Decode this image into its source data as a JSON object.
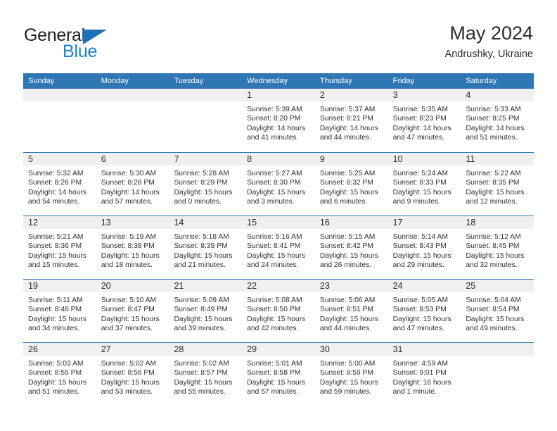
{
  "brand": {
    "name_top": "General",
    "name_bottom": "Blue",
    "triangle_icon": "triangle-logo-icon",
    "color_dark": "#231f20",
    "color_blue": "#1c7fd4"
  },
  "header": {
    "title": "May 2024",
    "subtitle": "Andrushky, Ukraine"
  },
  "theme": {
    "header_blue": "#2f76b5",
    "daynum_band": "#f0f0f0",
    "text": "#303030"
  },
  "calendar": {
    "weekday_headers": [
      "Sunday",
      "Monday",
      "Tuesday",
      "Wednesday",
      "Thursday",
      "Friday",
      "Saturday"
    ],
    "weeks": [
      [
        {
          "day": "",
          "lines": []
        },
        {
          "day": "",
          "lines": []
        },
        {
          "day": "",
          "lines": []
        },
        {
          "day": "1",
          "lines": [
            "Sunrise: 5:39 AM",
            "Sunset: 8:20 PM",
            "Daylight: 14 hours",
            "and 41 minutes."
          ]
        },
        {
          "day": "2",
          "lines": [
            "Sunrise: 5:37 AM",
            "Sunset: 8:21 PM",
            "Daylight: 14 hours",
            "and 44 minutes."
          ]
        },
        {
          "day": "3",
          "lines": [
            "Sunrise: 5:35 AM",
            "Sunset: 8:23 PM",
            "Daylight: 14 hours",
            "and 47 minutes."
          ]
        },
        {
          "day": "4",
          "lines": [
            "Sunrise: 5:33 AM",
            "Sunset: 8:25 PM",
            "Daylight: 14 hours",
            "and 51 minutes."
          ]
        }
      ],
      [
        {
          "day": "5",
          "lines": [
            "Sunrise: 5:32 AM",
            "Sunset: 8:26 PM",
            "Daylight: 14 hours",
            "and 54 minutes."
          ]
        },
        {
          "day": "6",
          "lines": [
            "Sunrise: 5:30 AM",
            "Sunset: 8:28 PM",
            "Daylight: 14 hours",
            "and 57 minutes."
          ]
        },
        {
          "day": "7",
          "lines": [
            "Sunrise: 5:28 AM",
            "Sunset: 8:29 PM",
            "Daylight: 15 hours",
            "and 0 minutes."
          ]
        },
        {
          "day": "8",
          "lines": [
            "Sunrise: 5:27 AM",
            "Sunset: 8:30 PM",
            "Daylight: 15 hours",
            "and 3 minutes."
          ]
        },
        {
          "day": "9",
          "lines": [
            "Sunrise: 5:25 AM",
            "Sunset: 8:32 PM",
            "Daylight: 15 hours",
            "and 6 minutes."
          ]
        },
        {
          "day": "10",
          "lines": [
            "Sunrise: 5:24 AM",
            "Sunset: 8:33 PM",
            "Daylight: 15 hours",
            "and 9 minutes."
          ]
        },
        {
          "day": "11",
          "lines": [
            "Sunrise: 5:22 AM",
            "Sunset: 8:35 PM",
            "Daylight: 15 hours",
            "and 12 minutes."
          ]
        }
      ],
      [
        {
          "day": "12",
          "lines": [
            "Sunrise: 5:21 AM",
            "Sunset: 8:36 PM",
            "Daylight: 15 hours",
            "and 15 minutes."
          ]
        },
        {
          "day": "13",
          "lines": [
            "Sunrise: 5:19 AM",
            "Sunset: 8:38 PM",
            "Daylight: 15 hours",
            "and 18 minutes."
          ]
        },
        {
          "day": "14",
          "lines": [
            "Sunrise: 5:18 AM",
            "Sunset: 8:39 PM",
            "Daylight: 15 hours",
            "and 21 minutes."
          ]
        },
        {
          "day": "15",
          "lines": [
            "Sunrise: 5:16 AM",
            "Sunset: 8:41 PM",
            "Daylight: 15 hours",
            "and 24 minutes."
          ]
        },
        {
          "day": "16",
          "lines": [
            "Sunrise: 5:15 AM",
            "Sunset: 8:42 PM",
            "Daylight: 15 hours",
            "and 26 minutes."
          ]
        },
        {
          "day": "17",
          "lines": [
            "Sunrise: 5:14 AM",
            "Sunset: 8:43 PM",
            "Daylight: 15 hours",
            "and 29 minutes."
          ]
        },
        {
          "day": "18",
          "lines": [
            "Sunrise: 5:12 AM",
            "Sunset: 8:45 PM",
            "Daylight: 15 hours",
            "and 32 minutes."
          ]
        }
      ],
      [
        {
          "day": "19",
          "lines": [
            "Sunrise: 5:11 AM",
            "Sunset: 8:46 PM",
            "Daylight: 15 hours",
            "and 34 minutes."
          ]
        },
        {
          "day": "20",
          "lines": [
            "Sunrise: 5:10 AM",
            "Sunset: 8:47 PM",
            "Daylight: 15 hours",
            "and 37 minutes."
          ]
        },
        {
          "day": "21",
          "lines": [
            "Sunrise: 5:09 AM",
            "Sunset: 8:49 PM",
            "Daylight: 15 hours",
            "and 39 minutes."
          ]
        },
        {
          "day": "22",
          "lines": [
            "Sunrise: 5:08 AM",
            "Sunset: 8:50 PM",
            "Daylight: 15 hours",
            "and 42 minutes."
          ]
        },
        {
          "day": "23",
          "lines": [
            "Sunrise: 5:06 AM",
            "Sunset: 8:51 PM",
            "Daylight: 15 hours",
            "and 44 minutes."
          ]
        },
        {
          "day": "24",
          "lines": [
            "Sunrise: 5:05 AM",
            "Sunset: 8:53 PM",
            "Daylight: 15 hours",
            "and 47 minutes."
          ]
        },
        {
          "day": "25",
          "lines": [
            "Sunrise: 5:04 AM",
            "Sunset: 8:54 PM",
            "Daylight: 15 hours",
            "and 49 minutes."
          ]
        }
      ],
      [
        {
          "day": "26",
          "lines": [
            "Sunrise: 5:03 AM",
            "Sunset: 8:55 PM",
            "Daylight: 15 hours",
            "and 51 minutes."
          ]
        },
        {
          "day": "27",
          "lines": [
            "Sunrise: 5:02 AM",
            "Sunset: 8:56 PM",
            "Daylight: 15 hours",
            "and 53 minutes."
          ]
        },
        {
          "day": "28",
          "lines": [
            "Sunrise: 5:02 AM",
            "Sunset: 8:57 PM",
            "Daylight: 15 hours",
            "and 55 minutes."
          ]
        },
        {
          "day": "29",
          "lines": [
            "Sunrise: 5:01 AM",
            "Sunset: 8:58 PM",
            "Daylight: 15 hours",
            "and 57 minutes."
          ]
        },
        {
          "day": "30",
          "lines": [
            "Sunrise: 5:00 AM",
            "Sunset: 8:59 PM",
            "Daylight: 15 hours",
            "and 59 minutes."
          ]
        },
        {
          "day": "31",
          "lines": [
            "Sunrise: 4:59 AM",
            "Sunset: 9:01 PM",
            "Daylight: 16 hours",
            "and 1 minute."
          ]
        },
        {
          "day": "",
          "lines": []
        }
      ]
    ]
  }
}
